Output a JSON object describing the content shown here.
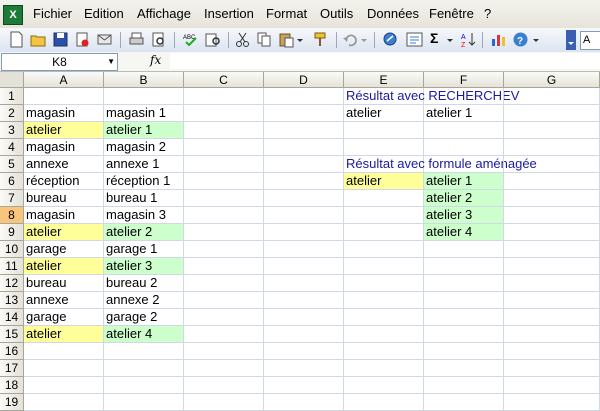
{
  "menu": [
    "Fichier",
    "Edition",
    "Affichage",
    "Insertion",
    "Format",
    "Outils",
    "Données",
    "Fenêtre",
    "?"
  ],
  "toolbar": {
    "sigma": "Σ",
    "font_partial": "A"
  },
  "namebox": "K8",
  "fx": "fx",
  "columns": [
    "A",
    "B",
    "C",
    "D",
    "E",
    "F",
    "G"
  ],
  "rows": [
    "1",
    "2",
    "3",
    "4",
    "5",
    "6",
    "7",
    "8",
    "9",
    "10",
    "11",
    "12",
    "13",
    "14",
    "15",
    "16",
    "17",
    "18",
    "19"
  ],
  "selected_row": "8",
  "colors": {
    "highlight_yellow": "#ffff99",
    "highlight_green": "#ccffcc",
    "heading_blue": "#1a1aa0"
  },
  "cells": {
    "A2": "magasin",
    "B2": "magasin 1",
    "A3": "atelier",
    "B3": "atelier 1",
    "A4": "magasin",
    "B4": "magasin 2",
    "A5": "annexe",
    "B5": "annexe 1",
    "A6": "réception",
    "B6": "réception 1",
    "A7": "bureau",
    "B7": "bureau 1",
    "A8": "magasin",
    "B8": "magasin 3",
    "A9": "atelier",
    "B9": "atelier 2",
    "A10": "garage",
    "B10": "garage 1",
    "A11": "atelier",
    "B11": "atelier 3",
    "A12": "bureau",
    "B12": "bureau 2",
    "A13": "annexe",
    "B13": "annexe 2",
    "A14": "garage",
    "B14": "garage 2",
    "A15": "atelier",
    "B15": "atelier 4",
    "E1": "Résultat avec RECHERCHEV",
    "E2": "atelier",
    "F2": "atelier 1",
    "E5": "Résultat avec formule aménagée",
    "E6": "atelier",
    "F6": "atelier 1",
    "F7": "atelier 2",
    "F8": "atelier 3",
    "F9": "atelier 4"
  }
}
